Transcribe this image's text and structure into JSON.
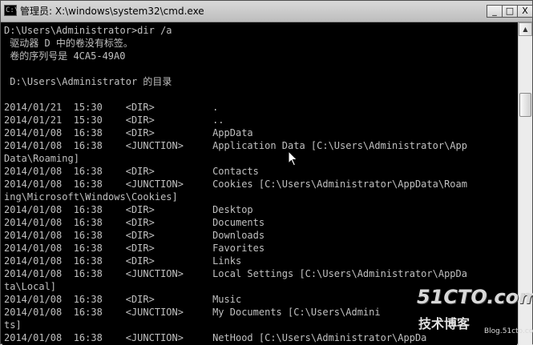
{
  "window": {
    "title": "管理员: X:\\windows\\system32\\cmd.exe",
    "icon_glyph": "C:\\",
    "minimize_glyph": "_",
    "maximize_glyph": "□",
    "close_glyph": "X"
  },
  "console": {
    "lines": [
      "D:\\Users\\Administrator>dir /a",
      " 驱动器 D 中的卷没有标签。",
      " 卷的序列号是 4CA5-49A0",
      "",
      " D:\\Users\\Administrator 的目录",
      "",
      "2014/01/21  15:30    <DIR>          .",
      "2014/01/21  15:30    <DIR>          ..",
      "2014/01/08  16:38    <DIR>          AppData",
      "2014/01/08  16:38    <JUNCTION>     Application Data [C:\\Users\\Administrator\\App",
      "Data\\Roaming]",
      "2014/01/08  16:38    <DIR>          Contacts",
      "2014/01/08  16:38    <JUNCTION>     Cookies [C:\\Users\\Administrator\\AppData\\Roam",
      "ing\\Microsoft\\Windows\\Cookies]",
      "2014/01/08  16:38    <DIR>          Desktop",
      "2014/01/08  16:38    <DIR>          Documents",
      "2014/01/08  16:38    <DIR>          Downloads",
      "2014/01/08  16:38    <DIR>          Favorites",
      "2014/01/08  16:38    <DIR>          Links",
      "2014/01/08  16:38    <JUNCTION>     Local Settings [C:\\Users\\Administrator\\AppDa",
      "ta\\Local]",
      "2014/01/08  16:38    <DIR>          Music",
      "2014/01/08  16:38    <JUNCTION>     My Documents [C:\\Users\\Admini",
      "ts]",
      "2014/01/08  16:38    <JUNCTION>     NetHood [C:\\Users\\Administrator\\AppDa"
    ]
  },
  "scrollbar": {
    "up_glyph": "▲",
    "position": 0.22
  },
  "watermark": {
    "brand": "51CTO.com",
    "subtitle": "技术博客",
    "url": "Blog.51cto.com"
  }
}
